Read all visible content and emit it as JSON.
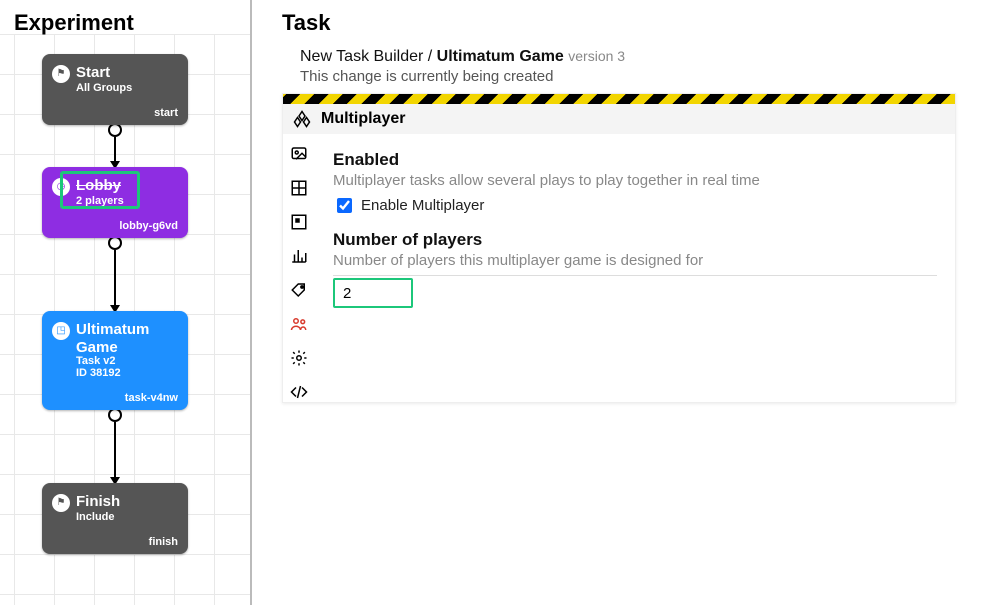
{
  "experiment": {
    "title": "Experiment",
    "nodes": {
      "start": {
        "title": "Start",
        "sub": "All Groups",
        "tag": "start"
      },
      "lobby": {
        "title": "Lobby",
        "sub": "2 players",
        "tag": "lobby-g6vd"
      },
      "task": {
        "title": "Ultimatum Game",
        "sub1": "Task v2",
        "sub2": "ID 38192",
        "tag": "task-v4nw"
      },
      "finish": {
        "title": "Finish",
        "sub": "Include",
        "tag": "finish"
      }
    }
  },
  "task": {
    "title": "Task",
    "breadcrumb": {
      "builder": "New Task Builder",
      "sep": "/",
      "name": "Ultimatum Game",
      "version": "version 3"
    },
    "status": "This change is currently being created",
    "section_header": "Multiplayer",
    "icons": {
      "multiplayer": "multiplayer-icon",
      "image": "image-icon",
      "grid": "grid-icon",
      "box": "box-icon",
      "chart": "chart-icon",
      "tag": "tag-icon",
      "people": "people-icon",
      "gear": "gear-icon",
      "code": "code-icon"
    },
    "enabled": {
      "title": "Enabled",
      "desc": "Multiplayer tasks allow several plays to play together in real time",
      "checkbox_label": "Enable Multiplayer",
      "checked": true
    },
    "players": {
      "title": "Number of players",
      "desc": "Number of players this multiplayer game is designed for",
      "value": "2"
    }
  }
}
